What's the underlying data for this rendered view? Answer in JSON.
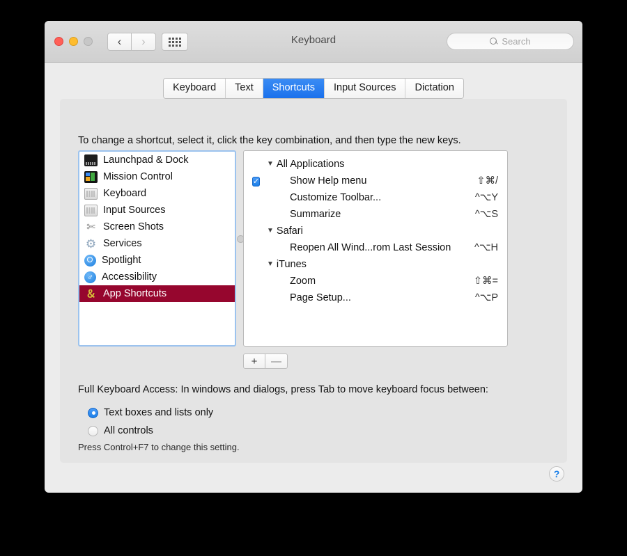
{
  "window": {
    "title": "Keyboard",
    "traffic_lights": [
      "close-button",
      "minimize-button",
      "zoom-button"
    ],
    "back_label": "‹",
    "forward_label": "›",
    "grid_label": "show-all-icon"
  },
  "search": {
    "placeholder": "Search",
    "value": ""
  },
  "tabs": [
    {
      "label": "Keyboard",
      "active": false
    },
    {
      "label": "Text",
      "active": false
    },
    {
      "label": "Shortcuts",
      "active": true
    },
    {
      "label": "Input Sources",
      "active": false
    },
    {
      "label": "Dictation",
      "active": false
    }
  ],
  "hint": "To change a shortcut, select it, click the key combination, and then type the new keys.",
  "sidebar": {
    "items": [
      {
        "label": "Launchpad & Dock",
        "icon": "launchpad-dock-icon",
        "selected": false
      },
      {
        "label": "Mission Control",
        "icon": "mission-control-icon",
        "selected": false
      },
      {
        "label": "Keyboard",
        "icon": "keyboard-icon",
        "selected": false
      },
      {
        "label": "Input Sources",
        "icon": "input-sources-icon",
        "selected": false
      },
      {
        "label": "Screen Shots",
        "icon": "screen-shots-icon",
        "selected": false
      },
      {
        "label": "Services",
        "icon": "services-gear-icon",
        "selected": false
      },
      {
        "label": "Spotlight",
        "icon": "spotlight-icon",
        "selected": false
      },
      {
        "label": "Accessibility",
        "icon": "accessibility-icon",
        "selected": false
      },
      {
        "label": "App Shortcuts",
        "icon": "app-shortcuts-icon",
        "selected": true
      }
    ],
    "selection_color": "#96062e"
  },
  "shortcuts": {
    "groups": [
      {
        "name": "All Applications",
        "expanded": true,
        "items": [
          {
            "name": "Show Help menu",
            "keys": "⇧⌘/",
            "checked": true
          },
          {
            "name": "Customize Toolbar...",
            "keys": "^⌥Y",
            "checked": false
          },
          {
            "name": "Summarize",
            "keys": "^⌥S",
            "checked": false
          }
        ]
      },
      {
        "name": "Safari",
        "expanded": true,
        "items": [
          {
            "name": "Reopen All Wind...rom Last Session",
            "keys": "^⌥H",
            "checked": false
          }
        ]
      },
      {
        "name": "iTunes",
        "expanded": true,
        "items": [
          {
            "name": "Zoom",
            "keys": "⇧⌘=",
            "checked": false
          },
          {
            "name": "Page Setup...",
            "keys": "^⌥P",
            "checked": false
          }
        ]
      }
    ],
    "add_label": "+",
    "remove_label": "—"
  },
  "full_keyboard_access": {
    "label": "Full Keyboard Access: In windows and dialogs, press Tab to move keyboard focus between:",
    "options": [
      {
        "label": "Text boxes and lists only",
        "selected": true
      },
      {
        "label": "All controls",
        "selected": false
      }
    ],
    "note": "Press Control+F7 to change this setting."
  },
  "help_label": "?",
  "colors": {
    "accent": "#1c7fe8",
    "selection": "#96062e",
    "tab_active": "#1a71ec"
  }
}
